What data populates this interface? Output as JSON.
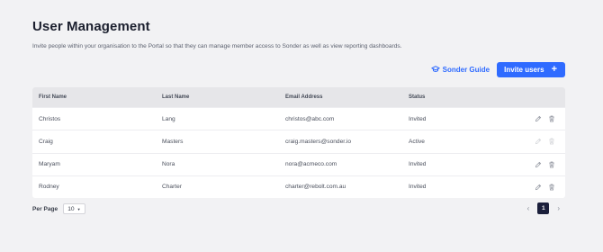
{
  "page": {
    "title": "User Management",
    "description": "Invite people within your organisation to the Portal so that they can manage member access to Sonder as well as view reporting dashboards."
  },
  "actions": {
    "guide_label": "Sonder Guide",
    "invite_label": "Invite users",
    "invite_icon": "+"
  },
  "table": {
    "headers": [
      "First Name",
      "Last Name",
      "Email Address",
      "Status"
    ],
    "rows": [
      {
        "first": "Christos",
        "last": "Lang",
        "email": "christos@abc.com",
        "status": "Invited"
      },
      {
        "first": "Craig",
        "last": "Masters",
        "email": "craig.masters@sonder.io",
        "status": "Active"
      },
      {
        "first": "Maryam",
        "last": "Nora",
        "email": "nora@acmeco.com",
        "status": "Invited"
      },
      {
        "first": "Rodney",
        "last": "Charter",
        "email": "charter@rebolt.com.au",
        "status": "Invited"
      }
    ]
  },
  "pagination": {
    "per_page_label": "Per Page",
    "per_page_value": "10",
    "current_page": "1",
    "prev_icon": "‹",
    "next_icon": "›"
  },
  "colors": {
    "accent": "#2f6bff",
    "background": "#f2f2f4",
    "active_page": "#1b1f3b"
  }
}
